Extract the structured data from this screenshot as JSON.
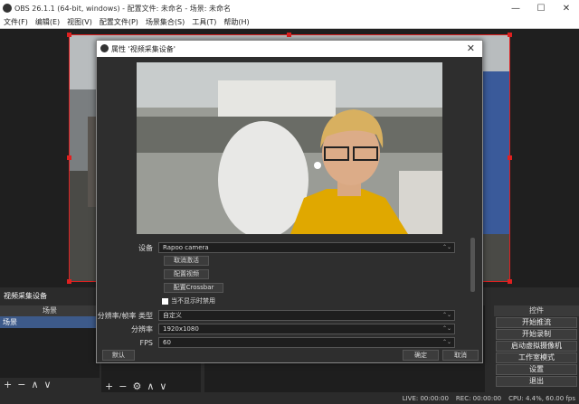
{
  "window": {
    "title": "OBS 26.1.1 (64-bit, windows) - 配置文件: 未命名 - 场景: 未命名"
  },
  "menu": [
    "文件(F)",
    "编辑(E)",
    "视图(V)",
    "配置文件(P)",
    "场景集合(S)",
    "工具(T)",
    "帮助(H)"
  ],
  "source_label": "视频采集设备",
  "docks": {
    "scenes_title": "场景",
    "scene_item": "场景",
    "controls_title": "控件",
    "controls": [
      "开始推流",
      "开始录制",
      "启动虚拟摄像机",
      "工作室模式",
      "设置",
      "退出"
    ]
  },
  "status": {
    "live": "LIVE: 00:00:00",
    "rec": "REC: 00:00:00",
    "cpu": "CPU: 4.4%, 60.00 fps"
  },
  "dialog": {
    "title": "属性 '视频采集设备'",
    "device_label": "设备",
    "device_value": "Rapoo camera",
    "btn_deactivate": "取消激活",
    "btn_config_video": "配置视频",
    "btn_crossbar": "配置Crossbar",
    "hide_label": "当不显示时禁用",
    "res_type_label": "分辨率/帧率 类型",
    "res_type_value": "自定义",
    "res_label": "分辨率",
    "res_value": "1920x1080",
    "fps_label": "FPS",
    "fps_value": "60",
    "btn_default": "默认",
    "btn_ok": "确定",
    "btn_cancel": "取消"
  }
}
